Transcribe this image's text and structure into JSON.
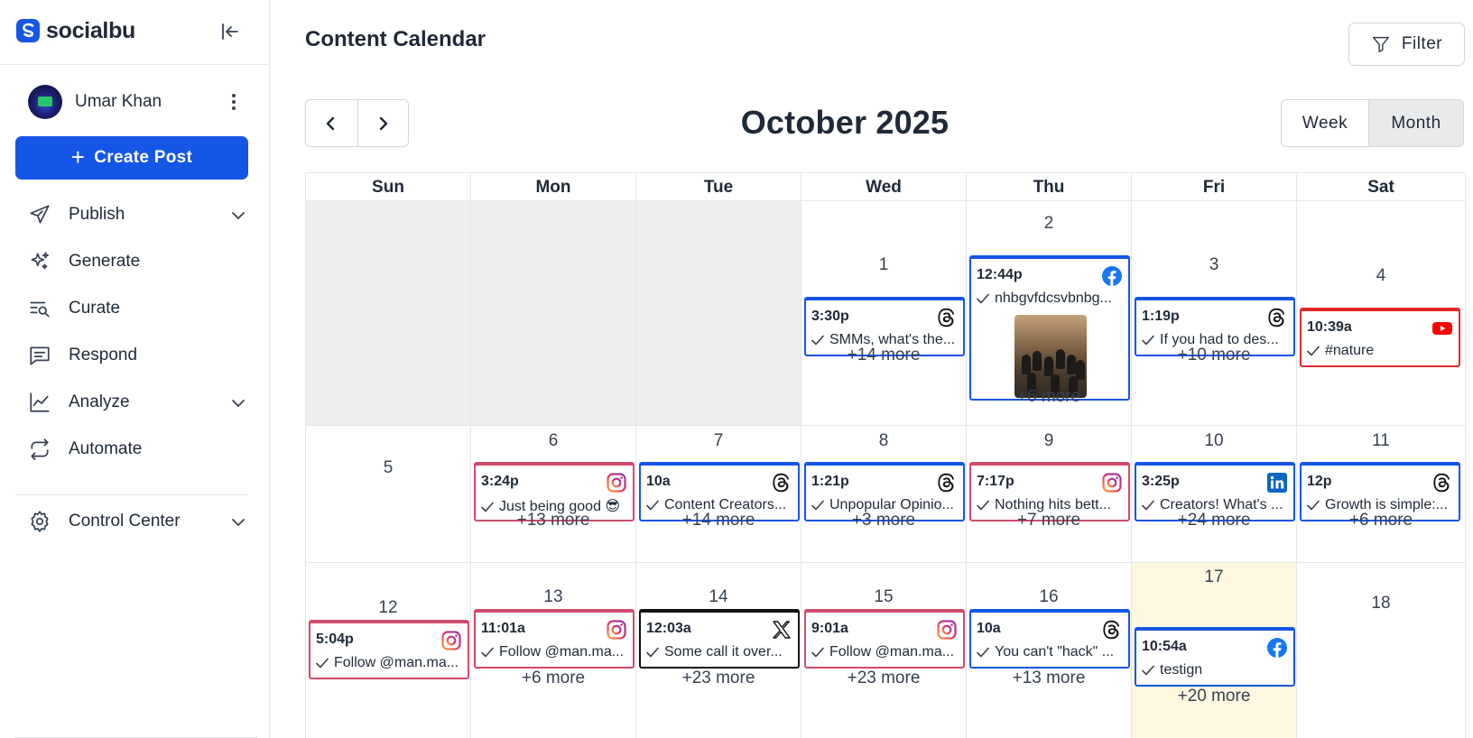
{
  "brand": {
    "name": "socialbu"
  },
  "user": {
    "name": "Umar Khan"
  },
  "sidebar": {
    "create_label": "Create Post",
    "items": [
      {
        "label": "Publish",
        "icon": "send-icon",
        "has_chevron": true
      },
      {
        "label": "Generate",
        "icon": "sparkle-icon",
        "has_chevron": false
      },
      {
        "label": "Curate",
        "icon": "curate-icon",
        "has_chevron": false
      },
      {
        "label": "Respond",
        "icon": "message-icon",
        "has_chevron": false
      },
      {
        "label": "Analyze",
        "icon": "chart-icon",
        "has_chevron": true
      },
      {
        "label": "Automate",
        "icon": "repeat-icon",
        "has_chevron": false
      },
      {
        "label": "Control Center",
        "icon": "gear-icon",
        "has_chevron": true
      }
    ]
  },
  "header": {
    "title": "Content Calendar",
    "filter_label": "Filter"
  },
  "calendar": {
    "month_title": "October 2025",
    "view_week": "Week",
    "view_month": "Month",
    "active_view": "Month",
    "weekdays": [
      "Sun",
      "Mon",
      "Tue",
      "Wed",
      "Thu",
      "Fri",
      "Sat"
    ],
    "days": {
      "d1": {
        "num": "1",
        "event": {
          "time": "3:30p",
          "text": "SMMs, what's the...",
          "platform": "threads"
        },
        "more": "+14 more"
      },
      "d2": {
        "num": "2",
        "event": {
          "time": "12:44p",
          "text": "nhbgvfdcsvbnbg...",
          "platform": "facebook",
          "image": true
        },
        "more": "+6 more"
      },
      "d3": {
        "num": "3",
        "event": {
          "time": "1:19p",
          "text": "If you had to des...",
          "platform": "threads"
        },
        "more": "+10 more"
      },
      "d4": {
        "num": "4",
        "event": {
          "time": "10:39a",
          "text": "#nature",
          "platform": "youtube"
        },
        "more": ""
      },
      "d5": {
        "num": "5",
        "event": null,
        "more": ""
      },
      "d6": {
        "num": "6",
        "event": {
          "time": "3:24p",
          "text": "Just being good 😎",
          "platform": "instagram"
        },
        "more": "+13 more"
      },
      "d7": {
        "num": "7",
        "event": {
          "time": "10a",
          "text": "Content Creators...",
          "platform": "threads"
        },
        "more": "+14 more"
      },
      "d8": {
        "num": "8",
        "event": {
          "time": "1:21p",
          "text": "Unpopular Opinio...",
          "platform": "threads"
        },
        "more": "+3 more"
      },
      "d9": {
        "num": "9",
        "event": {
          "time": "7:17p",
          "text": "Nothing hits bett...",
          "platform": "instagram"
        },
        "more": "+7 more"
      },
      "d10": {
        "num": "10",
        "event": {
          "time": "3:25p",
          "text": "Creators! What's ...",
          "platform": "linkedin"
        },
        "more": "+24 more"
      },
      "d11": {
        "num": "11",
        "event": {
          "time": "12p",
          "text": "Growth is simple:...",
          "platform": "threads"
        },
        "more": "+6 more"
      },
      "d12": {
        "num": "12",
        "event": {
          "time": "5:04p",
          "text": "Follow @man.ma...",
          "platform": "instagram"
        },
        "more": ""
      },
      "d13": {
        "num": "13",
        "event": {
          "time": "11:01a",
          "text": "Follow @man.ma...",
          "platform": "instagram"
        },
        "more": "+6 more"
      },
      "d14": {
        "num": "14",
        "event": {
          "time": "12:03a",
          "text": "Some call it over...",
          "platform": "x"
        },
        "more": "+23 more"
      },
      "d15": {
        "num": "15",
        "event": {
          "time": "9:01a",
          "text": "Follow @man.ma...",
          "platform": "instagram"
        },
        "more": "+23 more"
      },
      "d16": {
        "num": "16",
        "event": {
          "time": "10a",
          "text": "You can't \"hack\" ...",
          "platform": "threads"
        },
        "more": "+13 more"
      },
      "d17": {
        "num": "17",
        "event": {
          "time": "10:54a",
          "text": "testign",
          "platform": "facebook"
        },
        "more": "+20 more"
      },
      "d18": {
        "num": "18",
        "event": null,
        "more": ""
      }
    }
  },
  "colors": {
    "accent": "#1656e6",
    "instagram_border": "#d04a6b",
    "youtube": "#e12b2b",
    "today_bg": "#fdf8df"
  }
}
